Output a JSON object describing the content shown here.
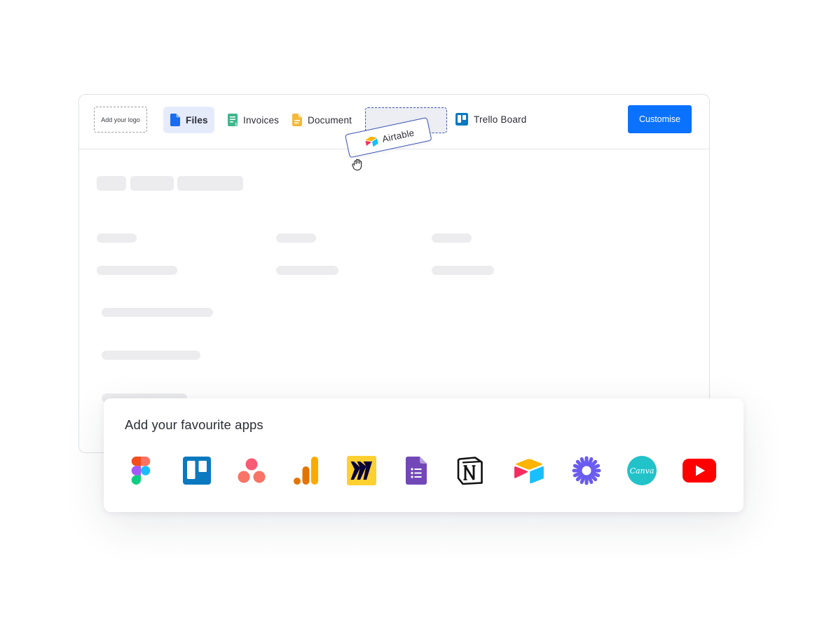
{
  "header": {
    "logo_placeholder": "Add your logo",
    "tabs": [
      {
        "label": "Files",
        "icon": "file-icon",
        "active": true
      },
      {
        "label": "Invoices",
        "icon": "invoice-icon"
      },
      {
        "label": "Document",
        "icon": "document-icon"
      },
      {
        "label": "Trello Board",
        "icon": "trello-icon"
      }
    ],
    "customise_label": "Customise"
  },
  "drag_item": {
    "label": "Airtable",
    "icon": "airtable-icon"
  },
  "apps_panel": {
    "title": "Add your favourite apps",
    "apps": [
      {
        "name": "figma-icon"
      },
      {
        "name": "trello-icon"
      },
      {
        "name": "asana-icon"
      },
      {
        "name": "google-analytics-icon"
      },
      {
        "name": "miro-icon"
      },
      {
        "name": "google-forms-icon"
      },
      {
        "name": "notion-icon"
      },
      {
        "name": "airtable-icon"
      },
      {
        "name": "zapier-icon"
      },
      {
        "name": "canva-icon",
        "text": "Canva"
      },
      {
        "name": "youtube-icon"
      }
    ]
  },
  "colors": {
    "accent": "#0a72ff",
    "active_tab_bg": "#e6ebfc",
    "skeleton": "#ececee",
    "drag_border": "#3a52b4"
  }
}
